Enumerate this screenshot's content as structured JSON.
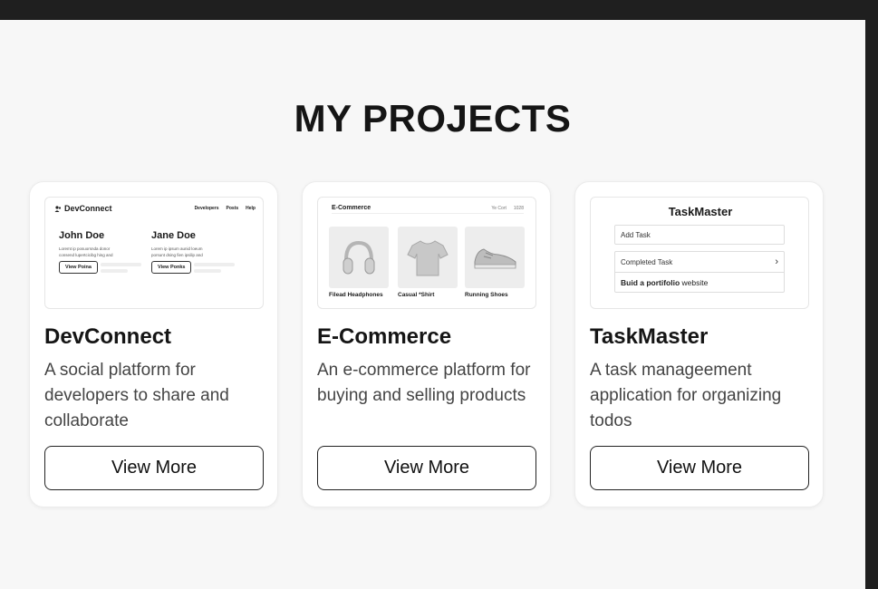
{
  "page": {
    "title": "MY PROJECTS"
  },
  "projects": [
    {
      "title": "DevConnect",
      "description": "A social platform for developers to share  and collaborate",
      "button": "View More",
      "preview": {
        "brand": "DevConnect",
        "nav_links": [
          "Developers",
          "Posts",
          "Help"
        ],
        "profiles": [
          {
            "name": "John Doe",
            "text": "Loremt ip posuorsnda donor consend lupertcicibg hing and",
            "button": "View Poina"
          },
          {
            "name": "Jane Doe",
            "text": "Lorem ip ipsum aunid loeum porsunt dsing fien ipsilip and",
            "button": "View Ponks"
          }
        ]
      }
    },
    {
      "title": "E-Commerce",
      "description": "An e-commerce platform for buying and selling products",
      "button": "View More",
      "preview": {
        "brand": "E-Commerce",
        "nav_links": [
          "Ye Cort",
          "1028"
        ],
        "items": [
          {
            "label": "Filead Headphones",
            "icon": "headphones-icon"
          },
          {
            "label": "Casual *Shirt",
            "icon": "tshirt-icon"
          },
          {
            "label": "Running Shoes",
            "icon": "shoe-icon"
          }
        ]
      }
    },
    {
      "title": "TaskMaster",
      "description": "A task manageement application for organizing todos",
      "button": "View More",
      "preview": {
        "title": "TaskMaster",
        "add_task": "Add Task",
        "completed": "Completed Task",
        "task_bold": "Buid a portifolio",
        "task_rest": " website"
      }
    }
  ]
}
